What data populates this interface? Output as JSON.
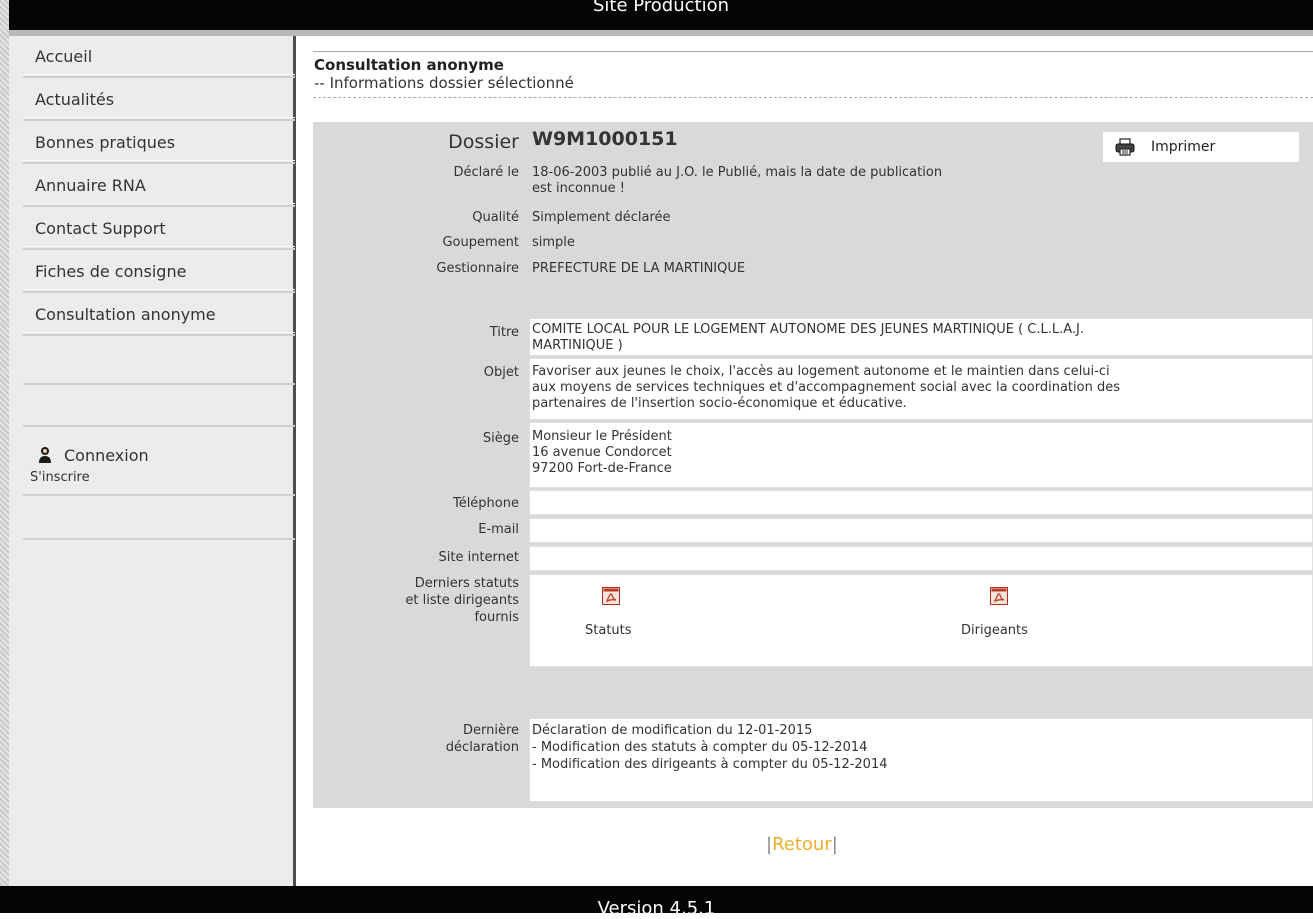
{
  "header": {
    "title": "Site Production"
  },
  "footer": {
    "version": "Version 4.5.1"
  },
  "sidebar": {
    "items": [
      {
        "label": "Accueil"
      },
      {
        "label": "Actualités"
      },
      {
        "label": "Bonnes pratiques"
      },
      {
        "label": "Annuaire RNA"
      },
      {
        "label": "Contact Support"
      },
      {
        "label": "Fiches de consigne"
      },
      {
        "label": "Consultation anonyme"
      }
    ],
    "login_label": "Connexion",
    "register_label": "S'inscrire"
  },
  "page": {
    "title": "Consultation anonyme",
    "subtitle": "-- Informations dossier sélectionné"
  },
  "dossier": {
    "label": "Dossier",
    "number": "W9M1000151",
    "print_label": "Imprimer",
    "declared_label": "Déclaré le",
    "declared_line1": "18-06-2003 publié au J.O. le Publié, mais la date de publication",
    "declared_line2": "est inconnue !",
    "quality_label": "Qualité",
    "quality": "Simplement déclarée",
    "grouping_label": "Goupement",
    "grouping": "simple",
    "manager_label": "Gestionnaire",
    "manager": "PREFECTURE DE LA MARTINIQUE",
    "title_label": "Titre",
    "title_line1": "COMITE LOCAL POUR LE LOGEMENT AUTONOME DES JEUNES MARTINIQUE ( C.L.L.A.J.",
    "title_line2": "MARTINIQUE )",
    "object_label": "Objet",
    "object_line1": "Favoriser aux jeunes le choix, l'accès au logement autonome et le maintien dans celui-ci",
    "object_line2": "aux moyens de services techniques et d'accompagnement social avec la coordination des",
    "object_line3": "partenaires de l'insertion socio-économique et éducative.",
    "seat_label": "Siège",
    "seat_line1": "Monsieur le Président",
    "seat_line2": "16 avenue Condorcet",
    "seat_line3": "97200 Fort-de-France",
    "phone_label": "Téléphone",
    "phone": "",
    "email_label": "E-mail",
    "email": "",
    "website_label": "Site internet",
    "website": "",
    "docs_label_line1": "Derniers statuts",
    "docs_label_line2": "et liste dirigeants",
    "docs_label_line3": "fournis",
    "statuts_label": "Statuts",
    "dirigeants_label": "Dirigeants",
    "last_decl_label_line1": "Dernière",
    "last_decl_label_line2": "déclaration",
    "last_decl_line1": "Déclaration de modification du 12-01-2015",
    "last_decl_line2": "- Modification des statuts à compter du 05-12-2014",
    "last_decl_line3": "- Modification des dirigeants à compter du 05-12-2014"
  },
  "nav": {
    "retour": "Retour",
    "bar": "|"
  },
  "icons": {
    "printer": "printer-icon",
    "pdf": "pdf-icon",
    "user": "user-icon"
  },
  "colors": {
    "link_accent": "#ecb030",
    "panel_bg": "#d9d9d9",
    "bar_bg": "#050505"
  }
}
